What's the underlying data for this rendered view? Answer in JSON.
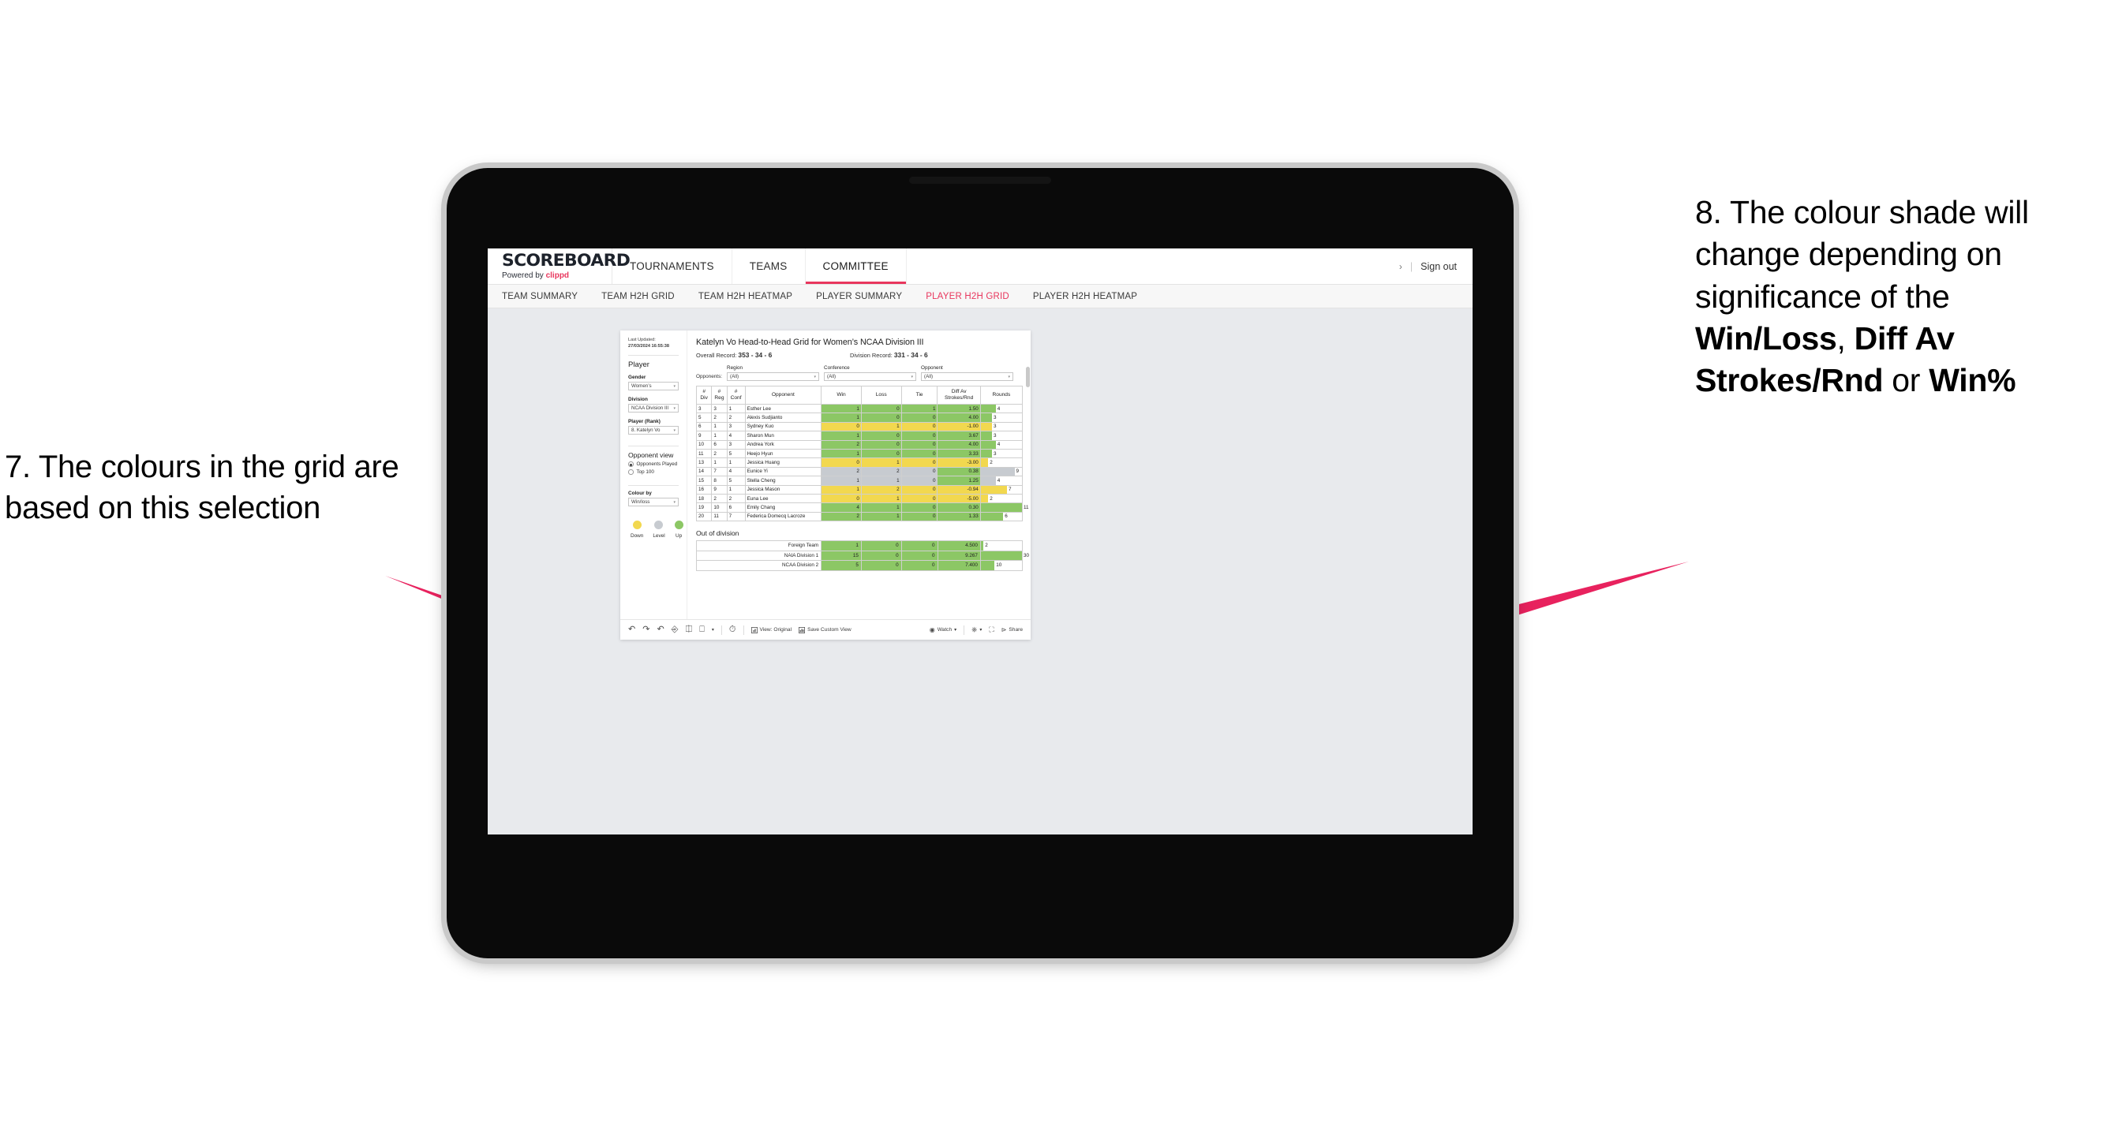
{
  "annotations": {
    "left": "7. The colours in the grid are based on this selection",
    "right_pre": "8. The colour shade will change depending on significance of the ",
    "right_b1": "Win/Loss",
    "right_mid1": ", ",
    "right_b2": "Diff Av Strokes/Rnd",
    "right_mid2": " or ",
    "right_b3": "Win%",
    "arrow_color": "#e8225e"
  },
  "app": {
    "brand": {
      "wordmark": "SCOREBOARD",
      "powered_prefix": "Powered by ",
      "powered_brand": "clippd"
    },
    "topnav": [
      {
        "label": "TOURNAMENTS",
        "active": false
      },
      {
        "label": "TEAMS",
        "active": false
      },
      {
        "label": "COMMITTEE",
        "active": true
      }
    ],
    "signout": {
      "chevron": "›",
      "divider": "|",
      "label": "Sign out"
    },
    "subnav": [
      {
        "label": "TEAM SUMMARY",
        "active": false
      },
      {
        "label": "TEAM H2H GRID",
        "active": false
      },
      {
        "label": "TEAM H2H HEATMAP",
        "active": false
      },
      {
        "label": "PLAYER SUMMARY",
        "active": false
      },
      {
        "label": "PLAYER H2H GRID",
        "active": true
      },
      {
        "label": "PLAYER H2H HEATMAP",
        "active": false
      }
    ]
  },
  "sidebar": {
    "last_updated_label": "Last Updated:",
    "last_updated_value": "27/03/2024 16:55:38",
    "player_heading": "Player",
    "gender_label": "Gender",
    "gender_value": "Women’s",
    "division_label": "Division",
    "division_value": "NCAA Division III",
    "player_rank_label": "Player (Rank)",
    "player_rank_value": "8. Katelyn Vo",
    "opponent_view_heading": "Opponent view",
    "opponent_view_options": [
      {
        "label": "Opponents Played",
        "selected": true
      },
      {
        "label": "Top 100",
        "selected": false
      }
    ],
    "colour_by_label": "Colour by",
    "colour_by_value": "Win/loss",
    "legend": [
      {
        "caption": "Down",
        "color": "#f2d84f"
      },
      {
        "caption": "Level",
        "color": "#c7cbd0"
      },
      {
        "caption": "Up",
        "color": "#8cc765"
      }
    ]
  },
  "view": {
    "title": "Katelyn Vo Head-to-Head Grid for Women’s NCAA Division III",
    "overall_record_label": "Overall Record:",
    "overall_record_value": "353 -  34 - 6",
    "division_record_label": "Division Record:",
    "division_record_value": "331 -  34 - 6",
    "opponents_label": "Opponents:",
    "filters": [
      {
        "title": "Region",
        "value": "(All)"
      },
      {
        "title": "Conference",
        "value": "(All)"
      },
      {
        "title": "Opponent",
        "value": "(All)"
      }
    ],
    "columns": [
      "#\nDiv",
      "#\nReg",
      "#\nConf",
      "Opponent",
      "Win",
      "Loss",
      "Tie",
      "Diff Av\nStrokes/Rnd",
      "Rounds"
    ],
    "col_div": "# Div",
    "col_reg": "# Reg",
    "col_conf": "# Conf",
    "col_opponent": "Opponent",
    "col_win": "Win",
    "col_loss": "Loss",
    "col_tie": "Tie",
    "col_diff_l1": "Diff Av",
    "col_diff_l2": "Strokes/Rnd",
    "col_rounds": "Rounds",
    "out_of_division_heading": "Out of division"
  },
  "chart_data": {
    "type": "table",
    "title": "Katelyn Vo Head-to-Head Grid for Women’s NCAA Division III",
    "colors": {
      "up": "#8cc765",
      "level": "#c7cbd0",
      "down": "#f2d84f",
      "bar_max_rounds": 11
    },
    "columns": [
      "#Div",
      "#Reg",
      "#Conf",
      "Opponent",
      "Win",
      "Loss",
      "Tie",
      "Diff Av Strokes/Rnd",
      "Rounds"
    ],
    "rows": [
      {
        "div": "3",
        "reg": "3",
        "conf": "1",
        "opponent": "Esther Lee",
        "win": "1",
        "loss": "0",
        "tie": "1",
        "diff": "1.50",
        "rounds": "4",
        "state": "up"
      },
      {
        "div": "5",
        "reg": "2",
        "conf": "2",
        "opponent": "Alexis Sudjianto",
        "win": "1",
        "loss": "0",
        "tie": "0",
        "diff": "4.00",
        "rounds": "3",
        "state": "up"
      },
      {
        "div": "6",
        "reg": "1",
        "conf": "3",
        "opponent": "Sydney Kuo",
        "win": "0",
        "loss": "1",
        "tie": "0",
        "diff": "-1.00",
        "rounds": "3",
        "state": "down"
      },
      {
        "div": "9",
        "reg": "1",
        "conf": "4",
        "opponent": "Sharon Mun",
        "win": "1",
        "loss": "0",
        "tie": "0",
        "diff": "3.67",
        "rounds": "3",
        "state": "up"
      },
      {
        "div": "10",
        "reg": "6",
        "conf": "3",
        "opponent": "Andrea York",
        "win": "2",
        "loss": "0",
        "tie": "0",
        "diff": "4.00",
        "rounds": "4",
        "state": "up"
      },
      {
        "div": "11",
        "reg": "2",
        "conf": "5",
        "opponent": "Heejo Hyun",
        "win": "1",
        "loss": "0",
        "tie": "0",
        "diff": "3.33",
        "rounds": "3",
        "state": "up"
      },
      {
        "div": "13",
        "reg": "1",
        "conf": "1",
        "opponent": "Jessica Huang",
        "win": "0",
        "loss": "1",
        "tie": "0",
        "diff": "-3.00",
        "rounds": "2",
        "state": "down"
      },
      {
        "div": "14",
        "reg": "7",
        "conf": "4",
        "opponent": "Eunice Yi",
        "win": "2",
        "loss": "2",
        "tie": "0",
        "diff": "0.38",
        "rounds": "9",
        "state": "level",
        "diff_state": "up"
      },
      {
        "div": "15",
        "reg": "8",
        "conf": "5",
        "opponent": "Stella Cheng",
        "win": "1",
        "loss": "1",
        "tie": "0",
        "diff": "1.25",
        "rounds": "4",
        "state": "level",
        "diff_state": "up"
      },
      {
        "div": "16",
        "reg": "9",
        "conf": "1",
        "opponent": "Jessica Mason",
        "win": "1",
        "loss": "2",
        "tie": "0",
        "diff": "-0.94",
        "rounds": "7",
        "state": "down"
      },
      {
        "div": "18",
        "reg": "2",
        "conf": "2",
        "opponent": "Euna Lee",
        "win": "0",
        "loss": "1",
        "tie": "0",
        "diff": "-5.00",
        "rounds": "2",
        "state": "down"
      },
      {
        "div": "19",
        "reg": "10",
        "conf": "6",
        "opponent": "Emily Chang",
        "win": "4",
        "loss": "1",
        "tie": "0",
        "diff": "0.30",
        "rounds": "11",
        "state": "up"
      },
      {
        "div": "20",
        "reg": "11",
        "conf": "7",
        "opponent": "Federica Domecq Lacroze",
        "win": "2",
        "loss": "1",
        "tie": "0",
        "diff": "1.33",
        "rounds": "6",
        "state": "up"
      }
    ],
    "out_of_division": {
      "heading": "Out of division",
      "max_rounds": 30,
      "rows": [
        {
          "opponent": "Foreign Team",
          "win": "1",
          "loss": "0",
          "tie": "0",
          "diff": "4.500",
          "rounds": "2",
          "state": "up"
        },
        {
          "opponent": "NAIA Division 1",
          "win": "15",
          "loss": "0",
          "tie": "0",
          "diff": "9.267",
          "rounds": "30",
          "state": "up"
        },
        {
          "opponent": "NCAA Division 2",
          "win": "5",
          "loss": "0",
          "tie": "0",
          "diff": "7.400",
          "rounds": "10",
          "state": "up"
        }
      ]
    }
  },
  "toolbar": {
    "view_label": "View: Original",
    "save_label": "Save Custom View",
    "watch_label": "Watch",
    "share_label": "Share",
    "caret": "▾"
  }
}
